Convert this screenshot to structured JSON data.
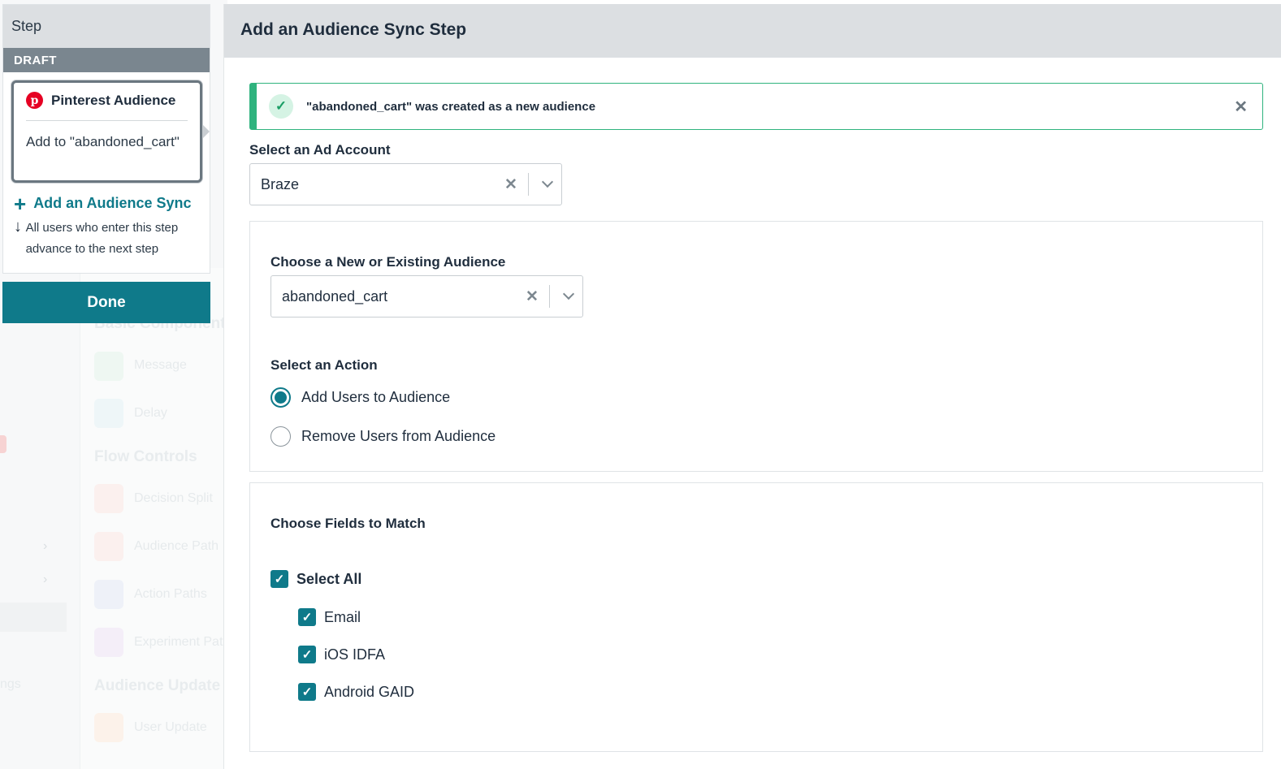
{
  "background": {
    "items": [
      "Message",
      "Delay",
      "Decision Split",
      "Audience Path",
      "Action Paths",
      "Experiment Pat",
      "User Update"
    ],
    "headings": [
      "Basic Component",
      "Flow Controls",
      "Audience Update"
    ],
    "left_stub": "ngs"
  },
  "step_panel": {
    "title": "Step",
    "draft_label": "DRAFT",
    "card": {
      "name": "Pinterest Audience",
      "icon": "pinterest-icon",
      "description": "Add to \"abandoned_cart\""
    },
    "add_sync_label": "Add an Audience Sync",
    "advance_text": "All users who enter this step advance to the next step",
    "done_label": "Done"
  },
  "modal": {
    "title": "Add an Audience Sync Step",
    "alert": {
      "message": "\"abandoned_cart\" was created as a new audience",
      "color": "#2fb37e"
    },
    "ad_account": {
      "label": "Select an Ad Account",
      "value": "Braze"
    },
    "audience": {
      "label": "Choose a New or Existing Audience",
      "value": "abandoned_cart"
    },
    "action": {
      "label": "Select an Action",
      "options": [
        {
          "label": "Add Users to Audience",
          "selected": true
        },
        {
          "label": "Remove Users from Audience",
          "selected": false
        }
      ]
    },
    "fields": {
      "label": "Choose Fields to Match",
      "select_all": {
        "label": "Select All",
        "checked": true
      },
      "options": [
        {
          "label": "Email",
          "checked": true
        },
        {
          "label": "iOS IDFA",
          "checked": true
        },
        {
          "label": "Android GAID",
          "checked": true
        }
      ]
    }
  },
  "colors": {
    "accent": "#0f7a8a",
    "header_bg": "#dcdfe2",
    "draft_bar": "#7a868f",
    "success": "#2fb37e",
    "pinterest": "#e60023"
  }
}
